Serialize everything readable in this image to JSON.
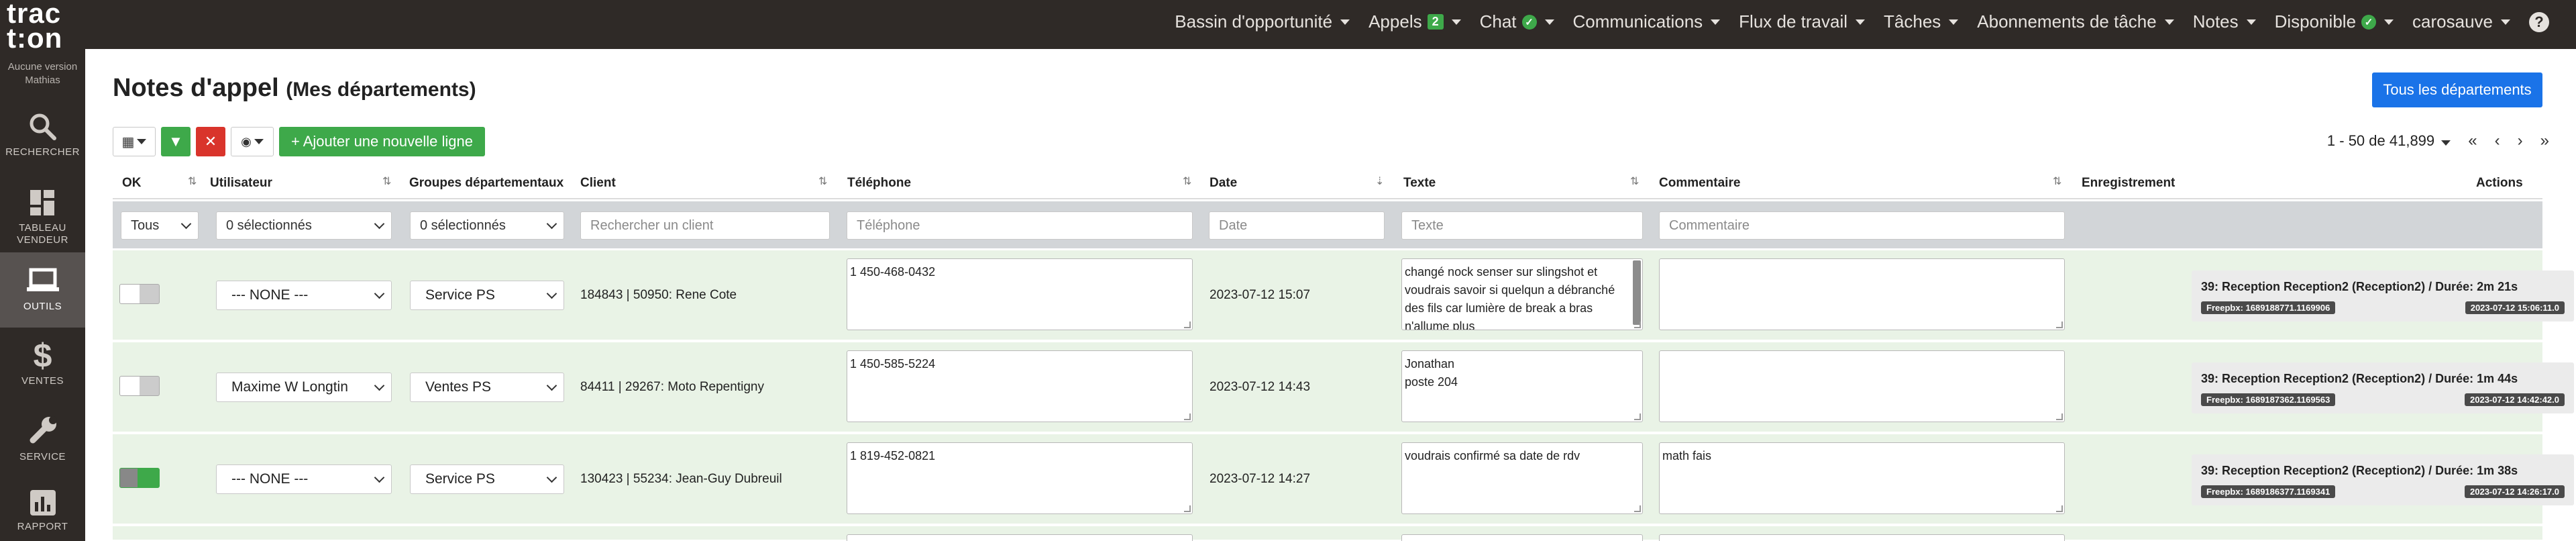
{
  "app": {
    "logo": "traction",
    "version_line1": "Aucune version",
    "version_line2": "Mathias"
  },
  "sidebar": {
    "items": [
      {
        "label": "RECHERCHER",
        "icon": "search-icon"
      },
      {
        "label_line1": "TABLEAU",
        "label_line2": "VENDEUR",
        "icon": "dashboard-icon"
      },
      {
        "label": "OUTILS",
        "icon": "laptop-icon",
        "active": true
      },
      {
        "label": "VENTES",
        "icon": "dollar-icon"
      },
      {
        "label": "SERVICE",
        "icon": "wrench-icon"
      },
      {
        "label": "RAPPORT",
        "icon": "chart-icon"
      }
    ]
  },
  "topnav": {
    "items": [
      {
        "label": "Bassin d'opportunité"
      },
      {
        "label": "Appels",
        "badge": "2"
      },
      {
        "label": "Chat",
        "status": "online"
      },
      {
        "label": "Communications"
      },
      {
        "label": "Flux de travail"
      },
      {
        "label": "Tâches"
      },
      {
        "label": "Abonnements de tâche"
      },
      {
        "label": "Notes"
      },
      {
        "label": "Disponible",
        "status": "online"
      },
      {
        "label": "carosauve"
      }
    ],
    "help": "?"
  },
  "page": {
    "title": "Notes d'appel",
    "subtitle": "(Mes départements)",
    "all_departments": "Tous les départements",
    "add_row": "+ Ajouter une nouvelle ligne",
    "pagination": "1 - 50 de 41,899"
  },
  "columns": {
    "ok": "OK",
    "user": "Utilisateur",
    "groups": "Groupes départementaux",
    "client": "Client",
    "phone": "Téléphone",
    "date": "Date",
    "text": "Texte",
    "comment": "Commentaire",
    "recording": "Enregistrement",
    "actions": "Actions"
  },
  "filters": {
    "ok": "Tous",
    "user": "0 sélectionnés",
    "groups": "0 sélectionnés",
    "client_placeholder": "Rechercher un client",
    "phone_placeholder": "Téléphone",
    "date_placeholder": "Date",
    "text_placeholder": "Texte",
    "comment_placeholder": "Commentaire"
  },
  "rows": [
    {
      "ok": false,
      "user": "--- NONE ---",
      "group": "Service PS",
      "client": "184843 | 50950: Rene Cote",
      "phone": "1 450-468-0432",
      "date": "2023-07-12 15:07",
      "text_line1": "changé nock senser sur slingshot et",
      "text_line2": "voudrais savoir si quelqun a débranché",
      "text_line3": "des fils car lumière de break a bras",
      "text_line4": "n'allume plus",
      "comment": "",
      "rec_title": "39: Reception Reception2 (Reception2) / Durée: 2m 21s",
      "rec_id": "Freepbx: 1689188771.1169906",
      "rec_time": "2023-07-12 15:06:11.0"
    },
    {
      "ok": false,
      "user": "Maxime W Longtin",
      "group": "Ventes PS",
      "client": "84411 | 29267: Moto Repentigny",
      "phone": "1 450-585-5224",
      "date": "2023-07-12 14:43",
      "text_line1": "Jonathan",
      "text_line2": "poste 204",
      "text_line3": "",
      "text_line4": "",
      "comment": "",
      "rec_title": "39: Reception Reception2 (Reception2) / Durée: 1m 44s",
      "rec_id": "Freepbx: 1689187362.1169563",
      "rec_time": "2023-07-12 14:42:42.0"
    },
    {
      "ok": true,
      "user": "--- NONE ---",
      "group": "Service PS",
      "client": "130423 | 55234: Jean-Guy Dubreuil",
      "phone": "1 819-452-0821",
      "date": "2023-07-12 14:27",
      "text_line1": "voudrais confirmé sa date de rdv",
      "text_line2": "",
      "text_line3": "",
      "text_line4": "",
      "comment": "math fais",
      "rec_title": "39: Reception Reception2 (Reception2) / Durée: 1m 38s",
      "rec_id": "Freepbx: 1689186377.1169341",
      "rec_time": "2023-07-12 14:26:17.0"
    }
  ],
  "colors": {
    "topbar": "#2f2a27",
    "primary": "#1a73e8",
    "success": "#3ea94a",
    "danger": "#d9342b",
    "row_bg": "#e9f3e6"
  }
}
